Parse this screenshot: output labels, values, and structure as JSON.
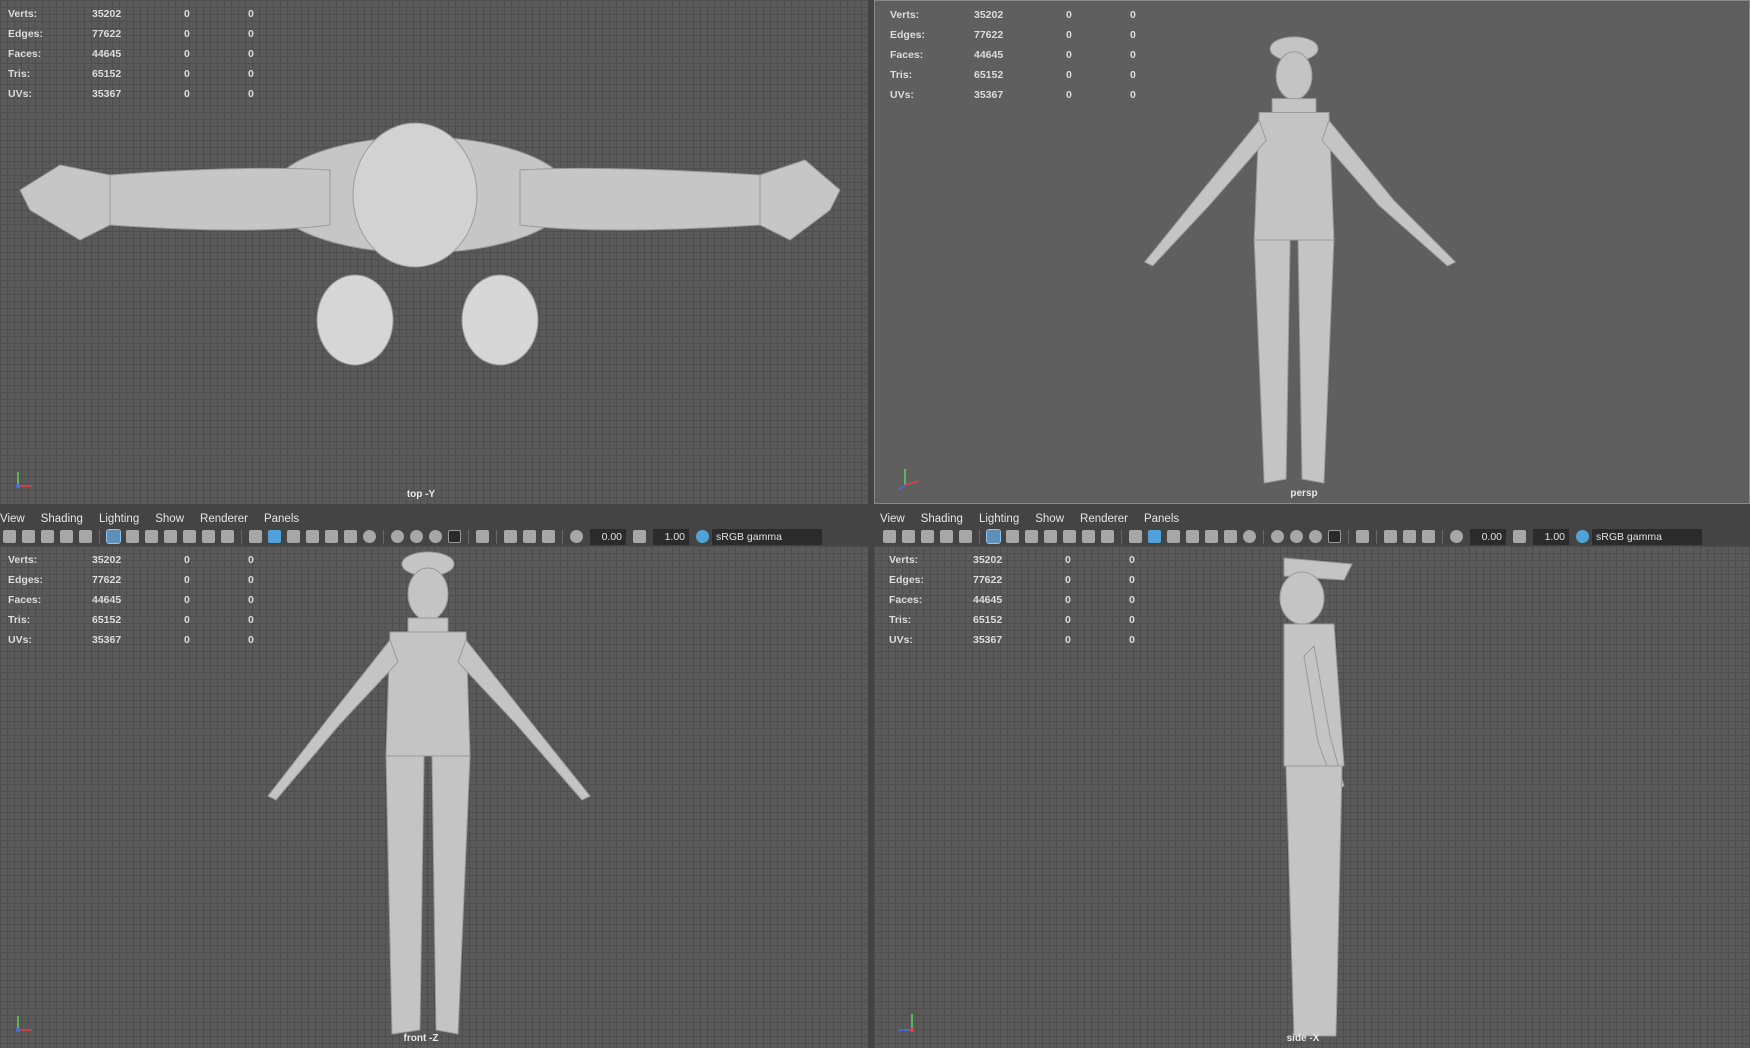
{
  "stats": {
    "rows": [
      {
        "label": "Verts:",
        "a": "35202",
        "b": "0",
        "c": "0"
      },
      {
        "label": "Edges:",
        "a": "77622",
        "b": "0",
        "c": "0"
      },
      {
        "label": "Faces:",
        "a": "44645",
        "b": "0",
        "c": "0"
      },
      {
        "label": "Tris:",
        "a": "65152",
        "b": "0",
        "c": "0"
      },
      {
        "label": "UVs:",
        "a": "35367",
        "b": "0",
        "c": "0"
      }
    ]
  },
  "panels": {
    "top": {
      "camera": "top -Y"
    },
    "persp": {
      "camera": "persp"
    },
    "front": {
      "camera": "front -Z"
    },
    "side": {
      "camera": "side -X"
    }
  },
  "menu": {
    "view": "View",
    "shading": "Shading",
    "lighting": "Lighting",
    "show": "Show",
    "renderer": "Renderer",
    "panels": "Panels"
  },
  "toolbar": {
    "exposure": "0.00",
    "gamma_value": "1.00",
    "colorspace": "sRGB gamma"
  },
  "axis": {
    "y": "y",
    "x": "x",
    "z": "z"
  },
  "colors": {
    "viewport_bg": "#5a5a5a",
    "grid_line": "#4e4e4e",
    "model": "#c8c8c8",
    "axis_x": "#e04040",
    "axis_y": "#60d060",
    "axis_z": "#4a6cf0"
  }
}
